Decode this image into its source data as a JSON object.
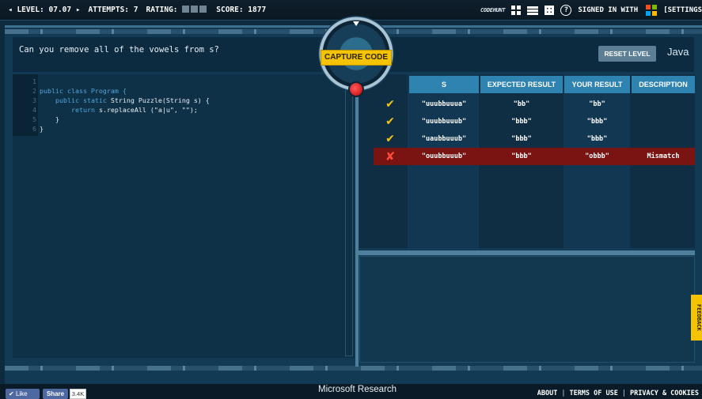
{
  "topbar": {
    "level_label": "LEVEL: 07.07",
    "attempts_label": "ATTEMPTS: 7",
    "rating_label": "RATING:",
    "score_label": "SCORE: 1877",
    "signed_in": "SIGNED IN WITH",
    "settings": "[SETTINGS",
    "logo_line1": "CODE",
    "logo_line2": "HUNT",
    "help_glyph": "?"
  },
  "question": "Can you remove all of the vowels from s?",
  "reset_label": "RESET LEVEL",
  "language": "Java",
  "capture_label": "CAPTURE CODE",
  "code": {
    "line_numbers": [
      "1",
      "2",
      "3",
      "4",
      "5",
      "6"
    ],
    "l2": "public class Program {",
    "l3_kw": "public static",
    "l3_rest": " String Puzzle(String s) {",
    "l4_kw": "return",
    "l4_rest": " s.replaceAll (\"a|u\", \"\");",
    "l5": "}",
    "l6": "}"
  },
  "table": {
    "headers": [
      "S",
      "EXPECTED RESULT",
      "YOUR RESULT",
      "DESCRIPTION"
    ],
    "rows": [
      {
        "status": "✔",
        "s": "\"uuubbuuua\"",
        "expected": "\"bb\"",
        "yours": "\"bb\"",
        "description": ""
      },
      {
        "status": "✔",
        "s": "\"uuubbuuub\"",
        "expected": "\"bbb\"",
        "yours": "\"bbb\"",
        "description": ""
      },
      {
        "status": "✔",
        "s": "\"uaubbuuub\"",
        "expected": "\"bbb\"",
        "yours": "\"bbb\"",
        "description": ""
      },
      {
        "status": "✘",
        "s": "\"ouubbuuub\"",
        "expected": "\"bbb\"",
        "yours": "\"obbb\"",
        "description": "Mismatch"
      }
    ]
  },
  "feedback_label": "FEEDBACK",
  "footer": {
    "like": "Like",
    "like_glyph": "✔",
    "share": "Share",
    "count": "3.4K",
    "ms_research": "Microsoft Research",
    "about": "ABOUT",
    "terms": "TERMS OF USE",
    "privacy": "PRIVACY & COOKIES",
    "separator": "|"
  },
  "colors": {
    "accent_yellow": "#f5c300",
    "table_header": "#2f83b0",
    "fail_row": "#7a1413"
  }
}
